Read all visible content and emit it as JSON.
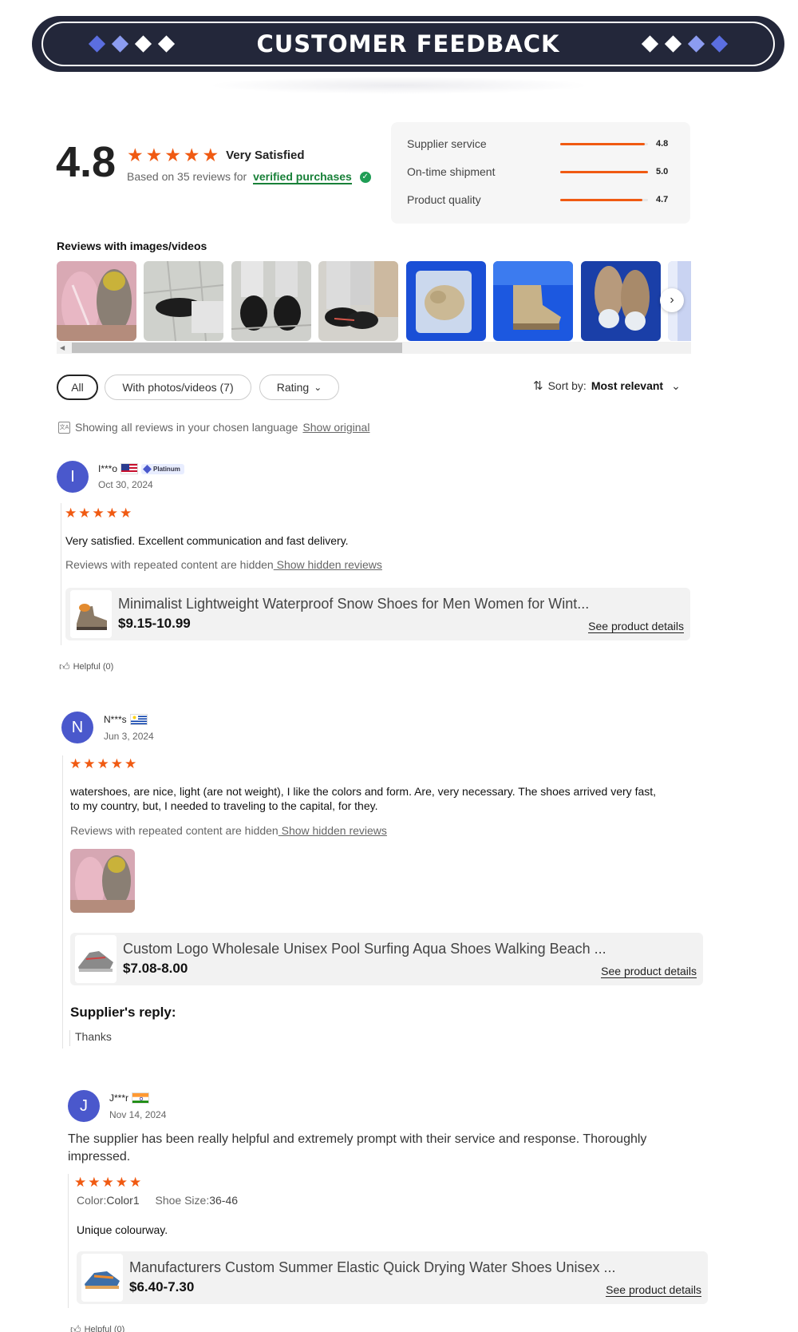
{
  "banner": {
    "title": "CUSTOMER FEEDBACK",
    "diamond_colors_left": [
      "#5b6ee0",
      "#8c9cf0",
      "#ffffff",
      "#ffffff"
    ],
    "diamond_colors_right": [
      "#ffffff",
      "#ffffff",
      "#8c9cf0",
      "#5b6ee0"
    ]
  },
  "summary": {
    "score": "4.8",
    "stars": 5,
    "label": "Very Satisfied",
    "based_prefix": "Based on 35 reviews for",
    "verified": "verified purchases",
    "sub_ratings": [
      {
        "label": "Supplier service",
        "value": "4.8"
      },
      {
        "label": "On-time shipment",
        "value": "5.0"
      },
      {
        "label": "Product quality",
        "value": "4.7"
      }
    ]
  },
  "gallery": {
    "title": "Reviews with images/videos",
    "thumbnails": [
      "pink-shoe-photo",
      "black-shoe-tile-photo",
      "black-shoes-feet-photo",
      "black-shoe-side-photo",
      "bagged-shoes-blue-photo",
      "tan-boot-blue-photo",
      "tan-boots-top-photo",
      "partial-photo"
    ]
  },
  "filters": {
    "all": "All",
    "photos": "With photos/videos (7)",
    "rating": "Rating",
    "sort_prefix": "Sort by:",
    "sort_value": "Most relevant"
  },
  "language_note": {
    "text": "Showing all reviews in your chosen language",
    "link": "Show original"
  },
  "reviews": [
    {
      "initial": "I",
      "name": "I***o",
      "badge": "Platinum",
      "date": "Oct 30, 2024",
      "text": "Very satisfied.  Excellent communication and fast delivery.",
      "hidden_prefix": "Reviews with repeated content are hidden",
      "hidden_link": " Show hidden reviews",
      "product_title": "Minimalist Lightweight Waterproof Snow Shoes for Men Women for Wint...",
      "product_price": "$9.15-10.99",
      "product_link": "See product details",
      "helpful": "Helpful (0)"
    },
    {
      "initial": "N",
      "name": "N***s",
      "date": "Jun 3, 2024",
      "text_line1": "watershoes, are nice, light (are not weight), I like the colors and form. Are, very necessary. The shoes arrived very fast,",
      "text_line2": "to my country, but, I needed to traveling to the capital, for they.",
      "hidden_prefix": "Reviews with repeated content are hidden",
      "hidden_link": " Show hidden reviews",
      "product_title": "Custom Logo Wholesale Unisex Pool Surfing Aqua Shoes Walking Beach ...",
      "product_price": "$7.08-8.00",
      "product_link": "See product details",
      "supplier_reply_title": "Supplier's reply:",
      "supplier_reply": "Thanks"
    },
    {
      "initial": "J",
      "name": "J***r",
      "date": "Nov 14, 2024",
      "headline_line1": "The supplier has been really helpful and extremely prompt with their service and response. Thoroughly",
      "headline_line2": "impressed.",
      "color_label": "Color:",
      "color_value": "Color1",
      "size_label": "Shoe Size:",
      "size_value": "36-46",
      "text": "Unique colourway.",
      "product_title": "Manufacturers Custom Summer Elastic Quick Drying Water Shoes Unisex ...",
      "product_price": "$6.40-7.30",
      "product_link": "See product details",
      "helpful": "Helpful (0)"
    }
  ]
}
